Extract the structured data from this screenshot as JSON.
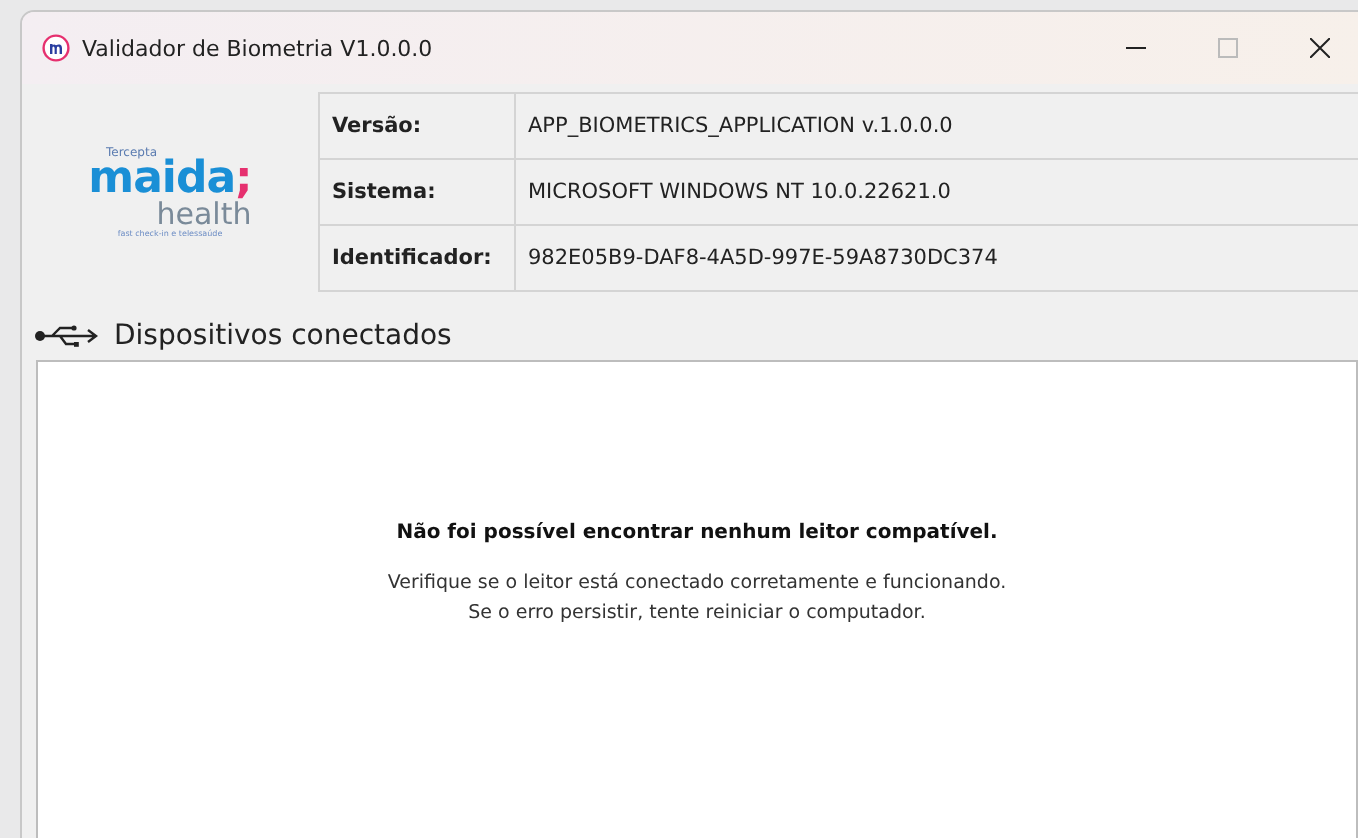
{
  "window": {
    "title": "Validador de Biometria V1.0.0.0"
  },
  "logo": {
    "eyebrow": "Tercepta",
    "brand": "maida",
    "brand_mark": ";",
    "sub": "health",
    "tagline": "fast check-in e telessaúde"
  },
  "info": [
    {
      "label": "Versão:",
      "value": "APP_BIOMETRICS_APPLICATION v.1.0.0.0"
    },
    {
      "label": "Sistema:",
      "value": "MICROSOFT WINDOWS NT 10.0.22621.0"
    },
    {
      "label": "Identificador:",
      "value": "982E05B9-DAF8-4A5D-997E-59A8730DC374"
    }
  ],
  "devices": {
    "heading": "Dispositivos conectados",
    "message_title": "Não foi possível encontrar nenhum leitor compatível.",
    "message_lines": [
      "Verifique se o leitor está conectado corretamente e funcionando.",
      "Se o erro persistir, tente reiniciar o computador."
    ]
  }
}
